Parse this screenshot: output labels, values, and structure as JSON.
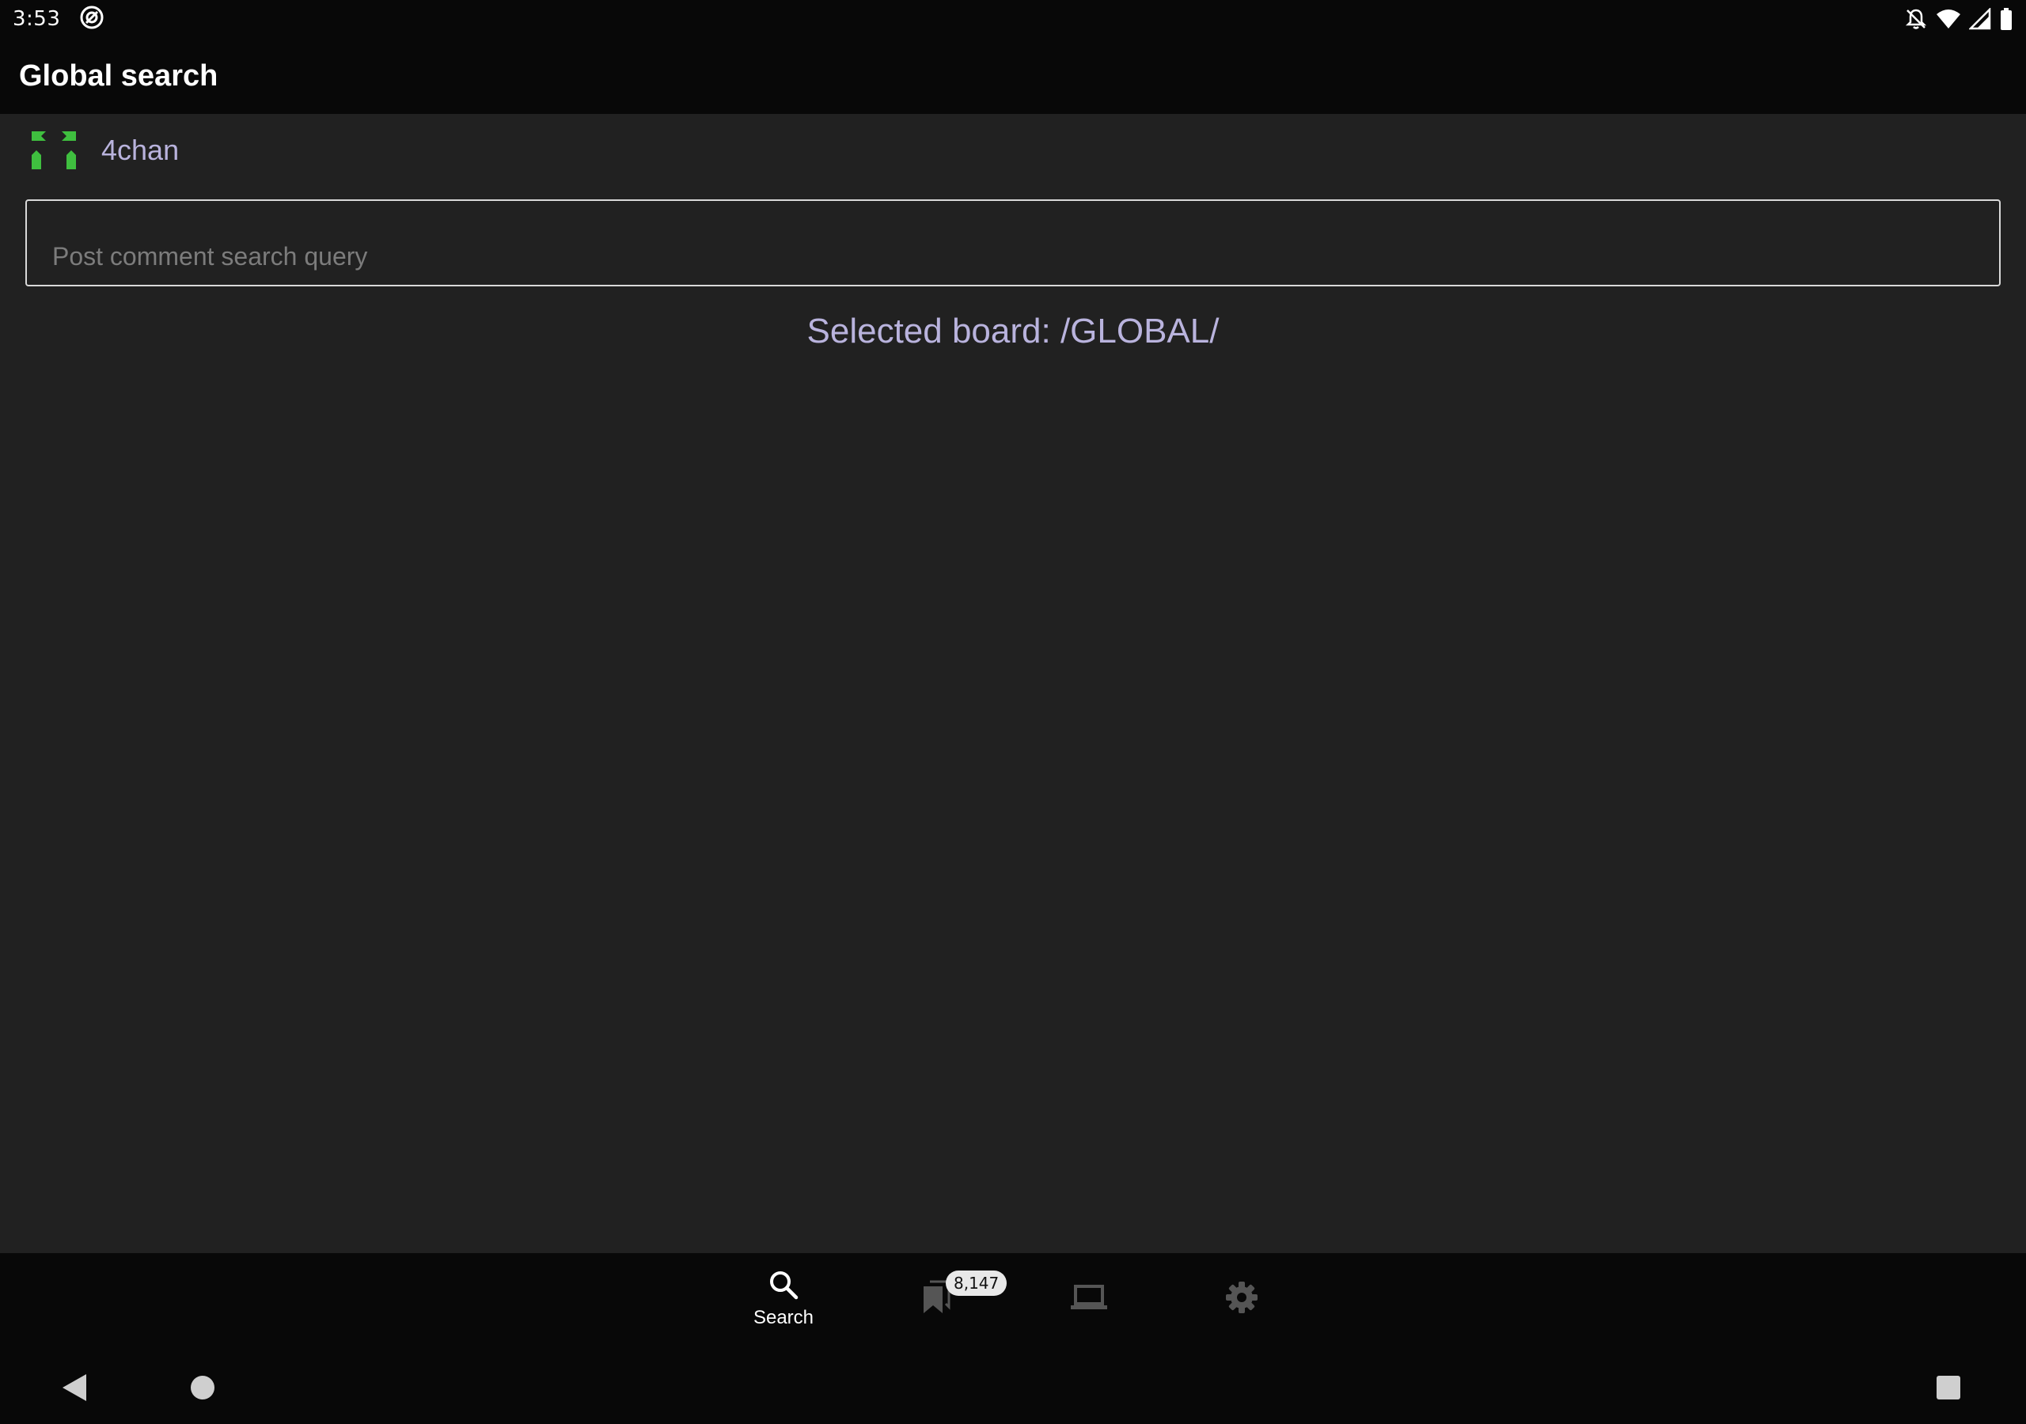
{
  "status_bar": {
    "time": "3:53"
  },
  "toolbar": {
    "title": "Global search"
  },
  "site": {
    "name": "4chan",
    "icon_color": "#3fbf3f"
  },
  "search": {
    "value": "",
    "placeholder": "Post comment search query"
  },
  "selected_board": "Selected board: /GLOBAL/",
  "bottom_nav": {
    "search_label": "Search",
    "bookmarks_badge": "8,147"
  },
  "colors": {
    "accent": "#b9b3dd",
    "background": "#212121",
    "bar": "#080808"
  }
}
